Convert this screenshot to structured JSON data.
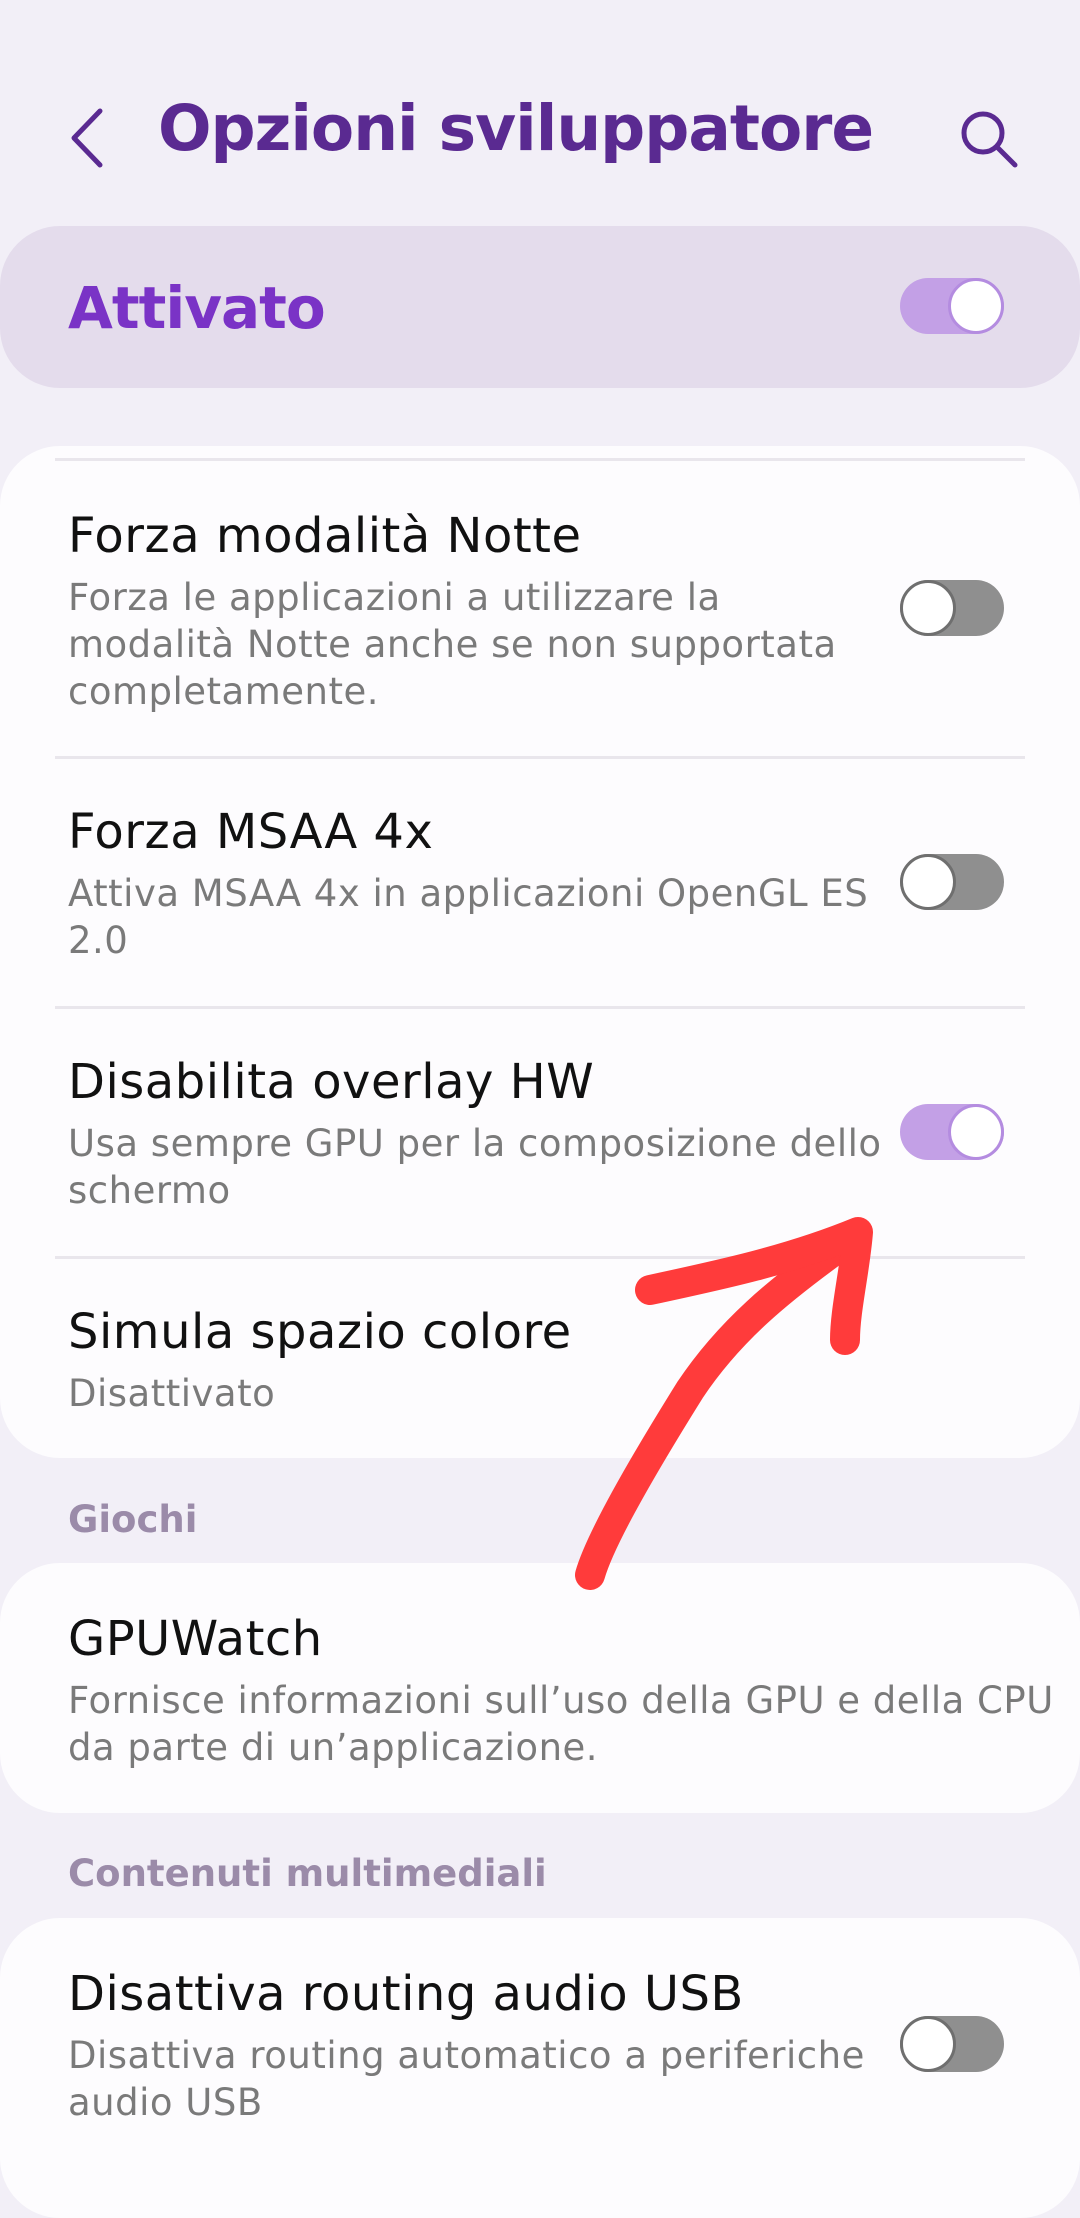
{
  "header": {
    "title": "Opzioni sviluppatore",
    "back_icon": "chevron-left-icon",
    "search_icon": "search-icon"
  },
  "master_switch": {
    "label": "Attivato",
    "on": true
  },
  "colors": {
    "accent": "#7a33c6",
    "title": "#5a2a91",
    "toggle_on": "#c3a0e6",
    "toggle_off": "#8f8f8f",
    "annotation_arrow": "#ff3b3b"
  },
  "settings": [
    {
      "title": "Forza modalità Notte",
      "lines": [
        "Forza le applicazioni a utilizzare la",
        "modalità Notte anche se non supportata",
        "completamente."
      ],
      "toggle": false
    },
    {
      "title": "Forza MSAA 4x",
      "lines": [
        "Attiva MSAA 4x in applicazioni OpenGL ES",
        "2.0"
      ],
      "toggle": false
    },
    {
      "title": "Disabilita overlay HW",
      "lines": [
        "Usa sempre GPU per la composizione dello",
        "schermo"
      ],
      "toggle": true
    },
    {
      "title": "Simula spazio colore",
      "lines": [
        "Disattivato"
      ]
    }
  ],
  "sections": {
    "games": "Giochi",
    "media": "Contenuti multimediali"
  },
  "gpuwatch": {
    "title": "GPUWatch",
    "lines": [
      "Fornisce informazioni sull’uso della GPU e della CPU",
      "da parte di un’applicazione."
    ]
  },
  "usb_audio": {
    "title": "Disattiva routing audio USB",
    "lines": [
      "Disattiva routing automatico a periferiche",
      "audio USB"
    ],
    "toggle": false
  }
}
